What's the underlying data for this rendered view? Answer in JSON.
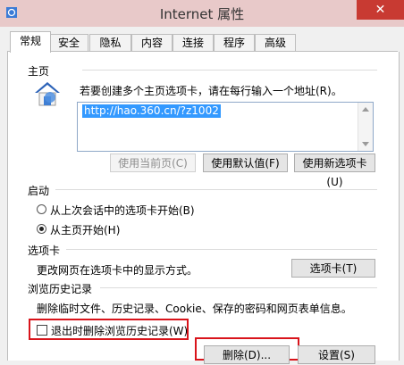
{
  "window": {
    "title": "Internet 属性",
    "close_glyph": "✕"
  },
  "tabs": [
    {
      "label": "常规",
      "active": true
    },
    {
      "label": "安全"
    },
    {
      "label": "隐私"
    },
    {
      "label": "内容"
    },
    {
      "label": "连接"
    },
    {
      "label": "程序"
    },
    {
      "label": "高级"
    }
  ],
  "home": {
    "section_label": "主页",
    "instruction": "若要创建多个主页选项卡，请在每行输入一个地址(R)。",
    "url": "http://hao.360.cn/?z1002",
    "btn_use_current": "使用当前页(C)",
    "btn_use_default": "使用默认值(F)",
    "btn_use_new_tab": "使用新选项卡(U)"
  },
  "startup": {
    "section_label": "启动",
    "option_last_session": "从上次会话中的选项卡开始(B)",
    "option_home": "从主页开始(H)",
    "selected": "option_home"
  },
  "tabs_section": {
    "section_label": "选项卡",
    "description": "更改网页在选项卡中的显示方式。",
    "btn_tabs": "选项卡(T)"
  },
  "history": {
    "section_label": "浏览历史记录",
    "description": "删除临时文件、历史记录、Cookie、保存的密码和网页表单信息。",
    "checkbox_delete_on_exit": "退出时删除浏览历史记录(W)",
    "checkbox_checked": false,
    "btn_delete": "删除(D)...",
    "btn_settings": "设置(S)"
  },
  "colors": {
    "highlight_red": "#d9141b",
    "selection_blue": "#3399ff",
    "close_red": "#c83a32"
  }
}
